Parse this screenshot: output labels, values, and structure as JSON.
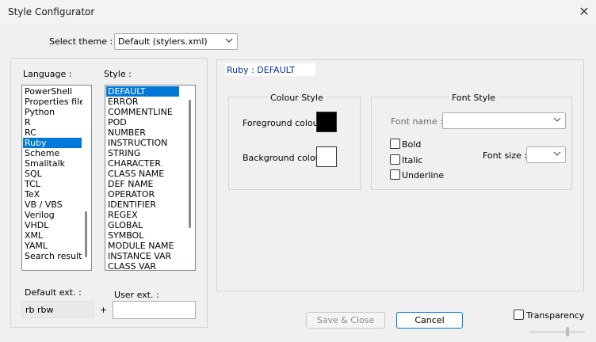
{
  "window": {
    "title": "Style Configurator",
    "close_glyph": "✕"
  },
  "theme": {
    "label": "Select theme :",
    "value": "Default (stylers.xml)"
  },
  "language": {
    "label": "Language :",
    "items": [
      "PowerShell",
      "Properties file",
      "Python",
      "R",
      "RC",
      "Ruby",
      "Scheme",
      "Smalltalk",
      "SQL",
      "TCL",
      "TeX",
      "VB / VBS",
      "Verilog",
      "VHDL",
      "XML",
      "YAML",
      "Search result"
    ],
    "selected_index": 5
  },
  "style": {
    "label": "Style :",
    "items": [
      "DEFAULT",
      "ERROR",
      "COMMENTLINE",
      "POD",
      "NUMBER",
      "INSTRUCTION",
      "STRING",
      "CHARACTER",
      "CLASS NAME",
      "DEF NAME",
      "OPERATOR",
      "IDENTIFIER",
      "REGEX",
      "GLOBAL",
      "SYMBOL",
      "MODULE NAME",
      "INSTANCE VAR",
      "CLASS VAR"
    ],
    "selected_index": 0
  },
  "ext": {
    "default_label": "Default ext. :",
    "default_value": "rb rbw",
    "plus": "+",
    "user_label": "User ext. :",
    "user_value": ""
  },
  "header": {
    "text": "Ruby : DEFAULT",
    "color": "#003399"
  },
  "colour_style": {
    "title": "Colour Style",
    "fg_label": "Foreground colour",
    "fg_color": "#000000",
    "bg_label": "Background colour",
    "bg_color": "#ffffff"
  },
  "font_style": {
    "title": "Font Style",
    "font_name_label": "Font name :",
    "font_name_value": "",
    "bold": "Bold",
    "italic": "Italic",
    "underline": "Underline",
    "font_size_label": "Font size :",
    "font_size_value": ""
  },
  "buttons": {
    "save_close": "Save & Close",
    "cancel": "Cancel"
  },
  "transparency": {
    "label": "Transparency"
  }
}
